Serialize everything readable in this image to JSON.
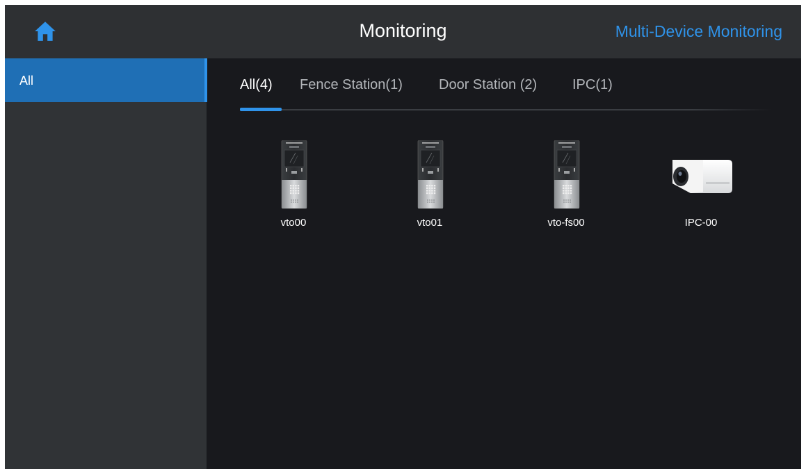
{
  "header": {
    "title": "Monitoring",
    "multi_device_label": "Multi-Device Monitoring",
    "home_icon": "home-icon"
  },
  "sidebar": {
    "items": [
      {
        "label": "All",
        "selected": true
      }
    ]
  },
  "tabs": [
    {
      "label": "All(4)",
      "active": true
    },
    {
      "label": "Fence Station(1)",
      "active": false
    },
    {
      "label": "Door Station (2)",
      "active": false
    },
    {
      "label": "IPC(1)",
      "active": false
    }
  ],
  "devices": [
    {
      "name": "vto00",
      "icon": "door-station-icon"
    },
    {
      "name": "vto01",
      "icon": "door-station-icon"
    },
    {
      "name": "vto-fs00",
      "icon": "door-station-icon"
    },
    {
      "name": "IPC-00",
      "icon": "bullet-camera-icon"
    }
  ],
  "colors": {
    "accent": "#2f93ea",
    "header_bg": "#2e3033",
    "sidebar_bg": "#303336",
    "content_bg": "#18191d",
    "selected_item_bg": "#1f6fb5"
  }
}
